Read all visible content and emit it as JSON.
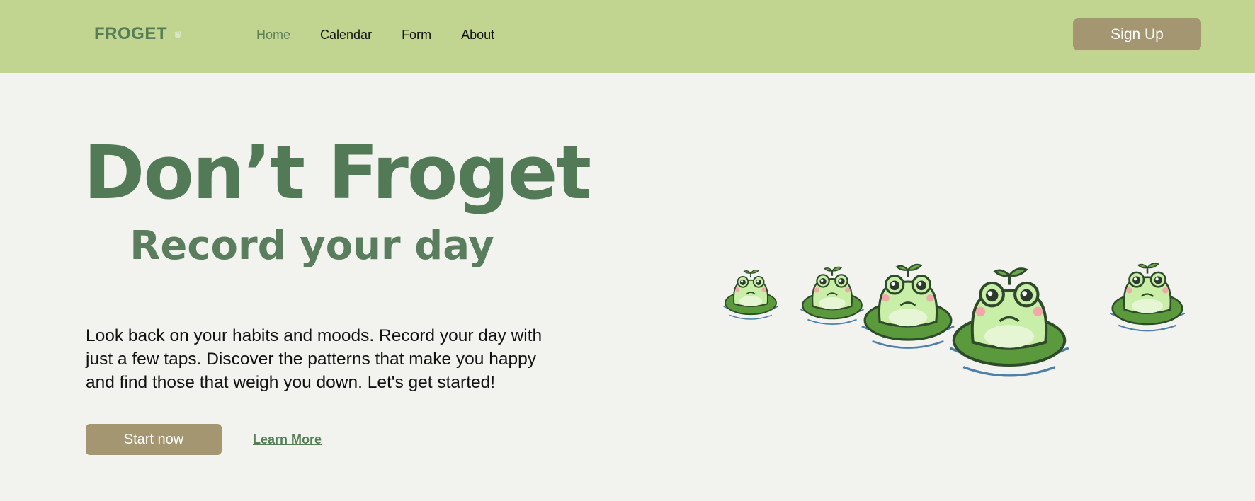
{
  "nav": {
    "brand": "FROGET",
    "links": [
      {
        "label": "Home",
        "active": true
      },
      {
        "label": "Calendar",
        "active": false
      },
      {
        "label": "Form",
        "active": false
      },
      {
        "label": "About",
        "active": false
      }
    ],
    "signup_label": "Sign Up"
  },
  "hero": {
    "title": "Don’t Froget",
    "subtitle": "Record your day",
    "description": "Look back on your habits and moods. Record your day with just a few taps. Discover the patterns that make you happy and find those that weigh you down. Let's get started!",
    "start_label": "Start now",
    "learn_label": "Learn More"
  },
  "colors": {
    "nav_bg": "#c1d590",
    "page_bg": "#f2f3ee",
    "accent_green": "#537a56",
    "button_tan": "#a39670"
  }
}
